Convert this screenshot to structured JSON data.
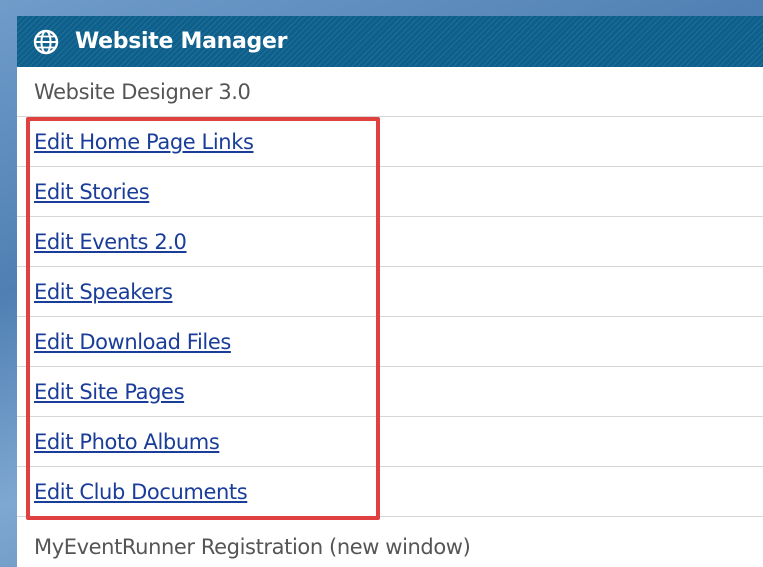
{
  "header": {
    "title": "Website Manager",
    "icon": "globe-icon"
  },
  "rows": {
    "designer": "Website Designer 3.0",
    "registration": "MyEventRunner Registration (new window)"
  },
  "links": [
    "Edit Home Page Links",
    "Edit Stories",
    "Edit Events 2.0",
    "Edit Speakers",
    "Edit Download Files",
    "Edit Site Pages",
    "Edit Photo Albums",
    "Edit Club Documents"
  ],
  "colors": {
    "header_bg": "#0d5f8c",
    "link": "#1a3d9a",
    "highlight": "#e0403f"
  }
}
